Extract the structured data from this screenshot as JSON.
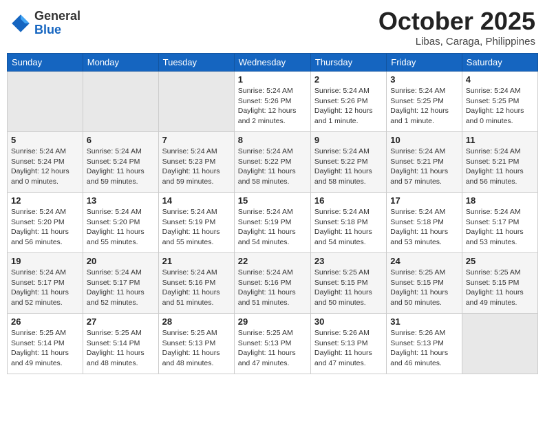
{
  "header": {
    "logo_general": "General",
    "logo_blue": "Blue",
    "month_title": "October 2025",
    "subtitle": "Libas, Caraga, Philippines"
  },
  "weekdays": [
    "Sunday",
    "Monday",
    "Tuesday",
    "Wednesday",
    "Thursday",
    "Friday",
    "Saturday"
  ],
  "weeks": [
    [
      {
        "day": "",
        "info": ""
      },
      {
        "day": "",
        "info": ""
      },
      {
        "day": "",
        "info": ""
      },
      {
        "day": "1",
        "info": "Sunrise: 5:24 AM\nSunset: 5:26 PM\nDaylight: 12 hours\nand 2 minutes."
      },
      {
        "day": "2",
        "info": "Sunrise: 5:24 AM\nSunset: 5:26 PM\nDaylight: 12 hours\nand 1 minute."
      },
      {
        "day": "3",
        "info": "Sunrise: 5:24 AM\nSunset: 5:25 PM\nDaylight: 12 hours\nand 1 minute."
      },
      {
        "day": "4",
        "info": "Sunrise: 5:24 AM\nSunset: 5:25 PM\nDaylight: 12 hours\nand 0 minutes."
      }
    ],
    [
      {
        "day": "5",
        "info": "Sunrise: 5:24 AM\nSunset: 5:24 PM\nDaylight: 12 hours\nand 0 minutes."
      },
      {
        "day": "6",
        "info": "Sunrise: 5:24 AM\nSunset: 5:24 PM\nDaylight: 11 hours\nand 59 minutes."
      },
      {
        "day": "7",
        "info": "Sunrise: 5:24 AM\nSunset: 5:23 PM\nDaylight: 11 hours\nand 59 minutes."
      },
      {
        "day": "8",
        "info": "Sunrise: 5:24 AM\nSunset: 5:22 PM\nDaylight: 11 hours\nand 58 minutes."
      },
      {
        "day": "9",
        "info": "Sunrise: 5:24 AM\nSunset: 5:22 PM\nDaylight: 11 hours\nand 58 minutes."
      },
      {
        "day": "10",
        "info": "Sunrise: 5:24 AM\nSunset: 5:21 PM\nDaylight: 11 hours\nand 57 minutes."
      },
      {
        "day": "11",
        "info": "Sunrise: 5:24 AM\nSunset: 5:21 PM\nDaylight: 11 hours\nand 56 minutes."
      }
    ],
    [
      {
        "day": "12",
        "info": "Sunrise: 5:24 AM\nSunset: 5:20 PM\nDaylight: 11 hours\nand 56 minutes."
      },
      {
        "day": "13",
        "info": "Sunrise: 5:24 AM\nSunset: 5:20 PM\nDaylight: 11 hours\nand 55 minutes."
      },
      {
        "day": "14",
        "info": "Sunrise: 5:24 AM\nSunset: 5:19 PM\nDaylight: 11 hours\nand 55 minutes."
      },
      {
        "day": "15",
        "info": "Sunrise: 5:24 AM\nSunset: 5:19 PM\nDaylight: 11 hours\nand 54 minutes."
      },
      {
        "day": "16",
        "info": "Sunrise: 5:24 AM\nSunset: 5:18 PM\nDaylight: 11 hours\nand 54 minutes."
      },
      {
        "day": "17",
        "info": "Sunrise: 5:24 AM\nSunset: 5:18 PM\nDaylight: 11 hours\nand 53 minutes."
      },
      {
        "day": "18",
        "info": "Sunrise: 5:24 AM\nSunset: 5:17 PM\nDaylight: 11 hours\nand 53 minutes."
      }
    ],
    [
      {
        "day": "19",
        "info": "Sunrise: 5:24 AM\nSunset: 5:17 PM\nDaylight: 11 hours\nand 52 minutes."
      },
      {
        "day": "20",
        "info": "Sunrise: 5:24 AM\nSunset: 5:17 PM\nDaylight: 11 hours\nand 52 minutes."
      },
      {
        "day": "21",
        "info": "Sunrise: 5:24 AM\nSunset: 5:16 PM\nDaylight: 11 hours\nand 51 minutes."
      },
      {
        "day": "22",
        "info": "Sunrise: 5:24 AM\nSunset: 5:16 PM\nDaylight: 11 hours\nand 51 minutes."
      },
      {
        "day": "23",
        "info": "Sunrise: 5:25 AM\nSunset: 5:15 PM\nDaylight: 11 hours\nand 50 minutes."
      },
      {
        "day": "24",
        "info": "Sunrise: 5:25 AM\nSunset: 5:15 PM\nDaylight: 11 hours\nand 50 minutes."
      },
      {
        "day": "25",
        "info": "Sunrise: 5:25 AM\nSunset: 5:15 PM\nDaylight: 11 hours\nand 49 minutes."
      }
    ],
    [
      {
        "day": "26",
        "info": "Sunrise: 5:25 AM\nSunset: 5:14 PM\nDaylight: 11 hours\nand 49 minutes."
      },
      {
        "day": "27",
        "info": "Sunrise: 5:25 AM\nSunset: 5:14 PM\nDaylight: 11 hours\nand 48 minutes."
      },
      {
        "day": "28",
        "info": "Sunrise: 5:25 AM\nSunset: 5:13 PM\nDaylight: 11 hours\nand 48 minutes."
      },
      {
        "day": "29",
        "info": "Sunrise: 5:25 AM\nSunset: 5:13 PM\nDaylight: 11 hours\nand 47 minutes."
      },
      {
        "day": "30",
        "info": "Sunrise: 5:26 AM\nSunset: 5:13 PM\nDaylight: 11 hours\nand 47 minutes."
      },
      {
        "day": "31",
        "info": "Sunrise: 5:26 AM\nSunset: 5:13 PM\nDaylight: 11 hours\nand 46 minutes."
      },
      {
        "day": "",
        "info": ""
      }
    ]
  ]
}
